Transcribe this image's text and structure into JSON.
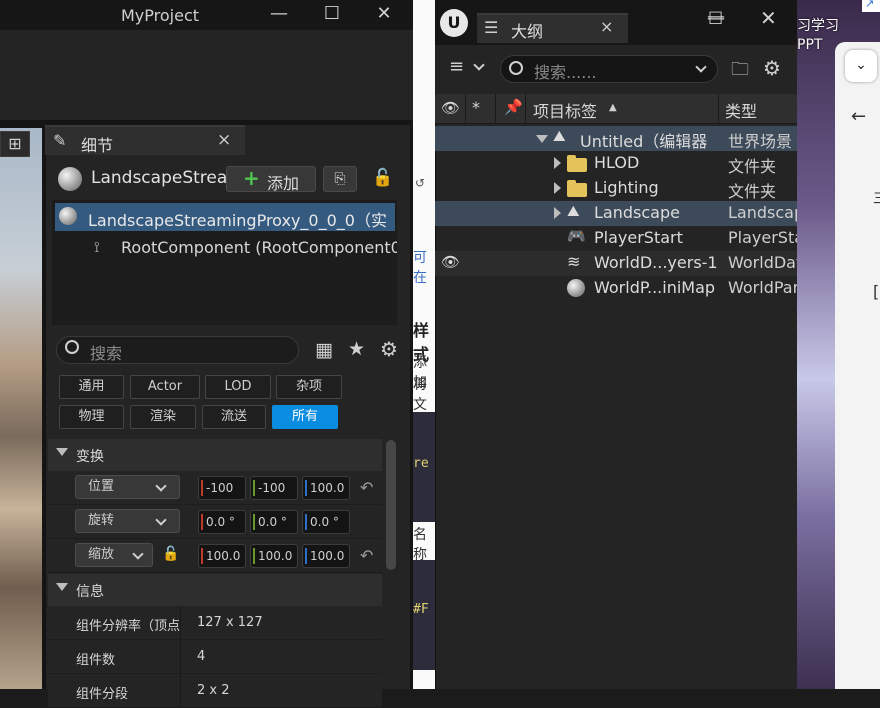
{
  "main_window": {
    "title": "MyProject",
    "controls": {
      "minimize": "—",
      "maximize": "☐",
      "close": "✕"
    }
  },
  "details": {
    "tab_label": "细节",
    "actor_name": "LandscapeStrea",
    "add_button": "添加",
    "components": [
      {
        "label": "LandscapeStreamingProxy_0_0_0（实"
      },
      {
        "label": "RootComponent (RootComponent0"
      }
    ],
    "search_placeholder": "搜索",
    "filters": [
      "通用",
      "Actor",
      "LOD",
      "杂项",
      "物理",
      "渲染",
      "流送",
      "所有"
    ],
    "active_filter": "所有",
    "sections": {
      "transform": {
        "title": "变换",
        "rows": [
          {
            "label": "位置",
            "values": [
              "-100",
              "-100",
              "100.0"
            ]
          },
          {
            "label": "旋转",
            "values": [
              "0.0 °",
              "0.0 °",
              "0.0 °"
            ]
          },
          {
            "label": "缩放",
            "values": [
              "100.0",
              "100.0",
              "100.0"
            ]
          }
        ]
      },
      "info": {
        "title": "信息",
        "rows": [
          {
            "key": "组件分辨率（顶点",
            "value": "127 x 127"
          },
          {
            "key": "组件数",
            "value": "4"
          },
          {
            "key": "组件分段",
            "value": "2 x 2"
          }
        ]
      }
    }
  },
  "outliner": {
    "tab_label": "大纲",
    "search_placeholder": "搜索......",
    "columns": {
      "label": "项目标签",
      "type": "类型"
    },
    "rows": [
      {
        "name": "Untitled（编辑器",
        "type": "世界场景",
        "icon": "world-icon"
      },
      {
        "name": "HLOD",
        "type": "文件夹",
        "icon": "folder-icon"
      },
      {
        "name": "Lighting",
        "type": "文件夹",
        "icon": "folder-icon"
      },
      {
        "name": "Landscape",
        "type": "Landscape",
        "icon": "landscape-icon"
      },
      {
        "name": "PlayerStart",
        "type": "PlayerStart",
        "icon": "player-start-icon"
      },
      {
        "name": "WorldD...yers-1",
        "type": "WorldData",
        "icon": "layers-icon"
      },
      {
        "name": "WorldP...iniMap",
        "type": "WorldPar",
        "icon": "sphere-icon"
      }
    ]
  },
  "web_fragments": [
    "可在",
    "样式",
    "添加",
    "将文",
    "re",
    "名称",
    "#F"
  ],
  "right_texts": [
    "习学习",
    "PPT",
    "三"
  ],
  "colors": {
    "accent_blue": "#0a8ce0",
    "selection": "#355a80",
    "x_axis": "#c0392b",
    "y_axis": "#6a9a2a",
    "z_axis": "#2f6fc7"
  }
}
